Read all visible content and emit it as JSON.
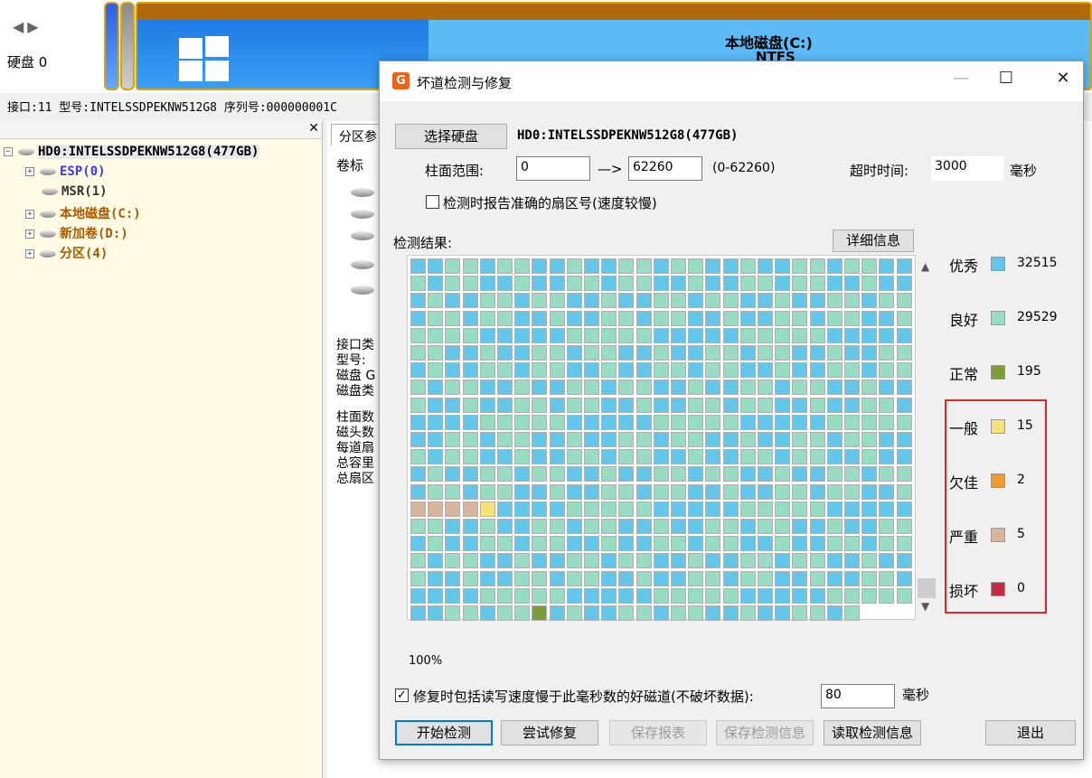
{
  "background": {
    "disk_label": "硬盘 0",
    "partition_c": {
      "name": "本地磁盘(C:)",
      "fs": "NTFS"
    },
    "info_bar": "接口:11  型号:INTELSSDPEKNW512G8  序列号:000000001C",
    "tree": [
      {
        "label": "HD0:INTELSSDPEKNW512G8(477GB)",
        "color": "#000000"
      },
      {
        "label": "ESP(0)",
        "color": "#3a3adf"
      },
      {
        "label": "MSR(1)",
        "color": "#333333"
      },
      {
        "label": "本地磁盘(C:)",
        "color": "#a85a00"
      },
      {
        "label": "新加卷(D:)",
        "color": "#a85a00"
      },
      {
        "label": "分区(4)",
        "color": "#a85a00"
      }
    ],
    "tab_partition": "分区参",
    "col_header": "卷标",
    "info_lines_1": [
      "接口类",
      "型号:",
      "磁盘 G",
      "磁盘类"
    ],
    "info_lines_2": [
      "柱面数",
      "磁头数",
      "每道扇",
      "总容里",
      "总扇区"
    ]
  },
  "dialog": {
    "title": "坏道检测与修复",
    "select_disk_label": "选择硬盘",
    "disk_name": "HD0:INTELSSDPEKNW512G8(477GB)",
    "cylinder_range_label": "柱面范围:",
    "range_from": "0",
    "arrow": "—>",
    "range_to": "62260",
    "range_hint": "(0-62260)",
    "timeout_label": "超时时间:",
    "timeout_value": "3000",
    "timeout_unit": "毫秒",
    "report_exact_checkbox": {
      "checked": false,
      "label": "检测时报告准确的扇区号(速度较慢)"
    },
    "result_label": "检测结果:",
    "details_label": "详细信息",
    "legend": [
      {
        "name": "优秀",
        "color": "#63c7ec",
        "count": "32515"
      },
      {
        "name": "良好",
        "color": "#97dcc3",
        "count": "29529"
      },
      {
        "name": "正常",
        "color": "#7c9c36",
        "count": "195"
      },
      {
        "name": "一般",
        "color": "#f4e27c",
        "count": "15"
      },
      {
        "name": "欠佳",
        "color": "#ee9a2c",
        "count": "2"
      },
      {
        "name": "严重",
        "color": "#d8b49c",
        "count": "5"
      },
      {
        "name": "损坏",
        "color": "#c42a44",
        "count": "0"
      }
    ],
    "progress": "100%",
    "repair_slow_checkbox": {
      "checked": true,
      "label": "修复时包括读写速度慢于此毫秒数的好磁道(不破坏数据):"
    },
    "slow_ms_value": "80",
    "slow_ms_unit": "毫秒",
    "buttons": {
      "start": "开始检测",
      "try_repair": "尝试修复",
      "save_report": "保存报表",
      "save_info": "保存检测信息",
      "load_info": "读取检测信息",
      "exit": "退出"
    }
  }
}
